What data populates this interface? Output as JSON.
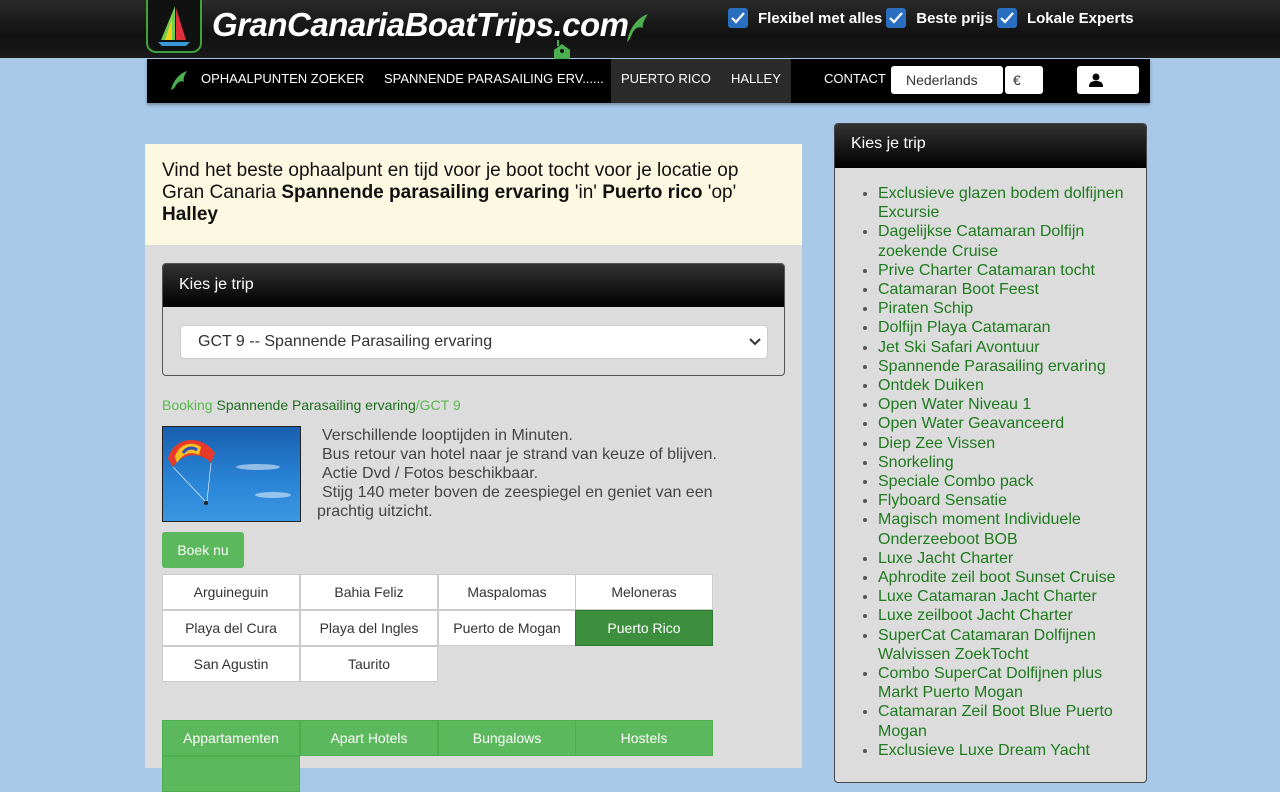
{
  "header": {
    "logo_text": "GranCanariaBoatTrips.com",
    "features": [
      "Flexibel met alles",
      "Beste prijs",
      "Lokale Experts"
    ]
  },
  "nav": {
    "items": [
      "OPHAALPUNTEN ZOEKER",
      "SPANNENDE PARASAILING ERV......",
      "PUERTO RICO",
      "HALLEY",
      "CONTACT"
    ],
    "language": "Nederlands",
    "currency": "€"
  },
  "notice": {
    "prefix": "Vind het beste ophaalpunt en tijd voor je boot tocht voor je locatie op Gran Canaria ",
    "trip": "Spannende parasailing ervaring",
    "in_word": " 'in' ",
    "location": "Puerto rico",
    "op_word": " 'op' ",
    "place": "Halley"
  },
  "trip_panel": {
    "title": "Kies je trip",
    "selected": "GCT 9 -- Spannende Parasailing ervaring"
  },
  "breadcrumb": {
    "booking": "Booking",
    "trip": "Spannende Parasailing ervaring",
    "code": "/GCT 9"
  },
  "description": [
    "Verschillende looptijden in Minuten.",
    "Bus retour van hotel naar je strand van keuze of blijven.",
    "Actie Dvd / Fotos beschikbaar.",
    "Stijg 140 meter boven de zeespiegel en geniet van een",
    "prachtig uitzicht."
  ],
  "book_button": "Boek nu",
  "locations": [
    "Arguineguin",
    "Bahia Feliz",
    "Maspalomas",
    "Meloneras",
    "Playa del Cura",
    "Playa del Ingles",
    "Puerto de Mogan",
    "Puerto Rico",
    "San Agustin",
    "Taurito"
  ],
  "active_location": "Puerto Rico",
  "accommodation": [
    "Appartamenten",
    "Apart Hotels",
    "Bungalows",
    "Hostels"
  ],
  "sidebar": {
    "title": "Kies je trip",
    "items": [
      "Exclusieve glazen bodem dolfijnen Excursie",
      "Dagelijkse Catamaran Dolfijn zoekende Cruise",
      "Prive Charter Catamaran tocht",
      "Catamaran Boot Feest",
      "Piraten Schip",
      "Dolfijn Playa Catamaran",
      "Jet Ski Safari Avontuur",
      "Spannende Parasailing ervaring",
      "Ontdek Duiken",
      "Open Water Niveau 1",
      "Open Water Geavanceerd",
      "Diep Zee Vissen",
      "Snorkeling",
      "Speciale Combo pack",
      "Flyboard Sensatie",
      "Magisch moment Individuele Onderzeeboot BOB",
      "Luxe Jacht Charter",
      "Aphrodite zeil boot Sunset Cruise",
      "Luxe Catamaran Jacht Charter",
      "Luxe zeilboot Jacht Charter",
      "SuperCat Catamaran Dolfijnen Walvissen ZoekTocht",
      "Combo SuperCat Dolfijnen plus Markt Puerto Mogan",
      "Catamaran Zeil Boot Blue Puerto Mogan",
      "Exclusieve Luxe Dream Yacht"
    ]
  },
  "colors": {
    "brand_green": "#5cb85c",
    "active_green": "#3d8f3d",
    "link_green": "#1e7a1e",
    "checkbox_blue": "#2a6fbf",
    "background": "#a8c8e8"
  },
  "icons": [
    "windsurf-logo-icon",
    "dolphin-icon",
    "price-tag-icon",
    "checkbox-checked-icon",
    "user-icon",
    "chevron-down-icon"
  ]
}
